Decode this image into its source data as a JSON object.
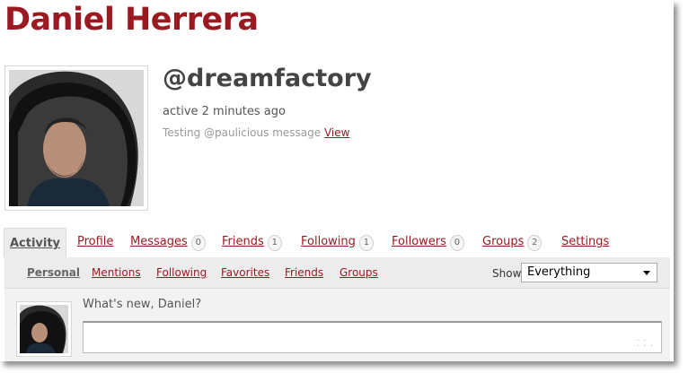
{
  "profile": {
    "display_name": "Daniel Herrera",
    "handle": "@dreamfactory",
    "last_active": "active 2 minutes ago",
    "status_text": "Testing @paulicious message",
    "status_link": "View"
  },
  "tabs": [
    {
      "label": "Activity",
      "count": null,
      "current": true
    },
    {
      "label": "Profile",
      "count": null
    },
    {
      "label": "Messages",
      "count": "0"
    },
    {
      "label": "Friends",
      "count": "1"
    },
    {
      "label": "Following",
      "count": "1"
    },
    {
      "label": "Followers",
      "count": "0"
    },
    {
      "label": "Groups",
      "count": "2"
    },
    {
      "label": "Settings",
      "count": null
    }
  ],
  "subnav": {
    "items": [
      "Personal",
      "Mentions",
      "Following",
      "Favorites",
      "Friends",
      "Groups"
    ],
    "show_label": "Show:",
    "show_value": "Everything"
  },
  "whats_new": {
    "label": "What's new, Daniel?",
    "value": ""
  },
  "colors": {
    "accent": "#9b1a22",
    "panel": "#ececec"
  },
  "icons": [
    "dropdown-arrow-icon",
    "resize-grip-icon"
  ]
}
